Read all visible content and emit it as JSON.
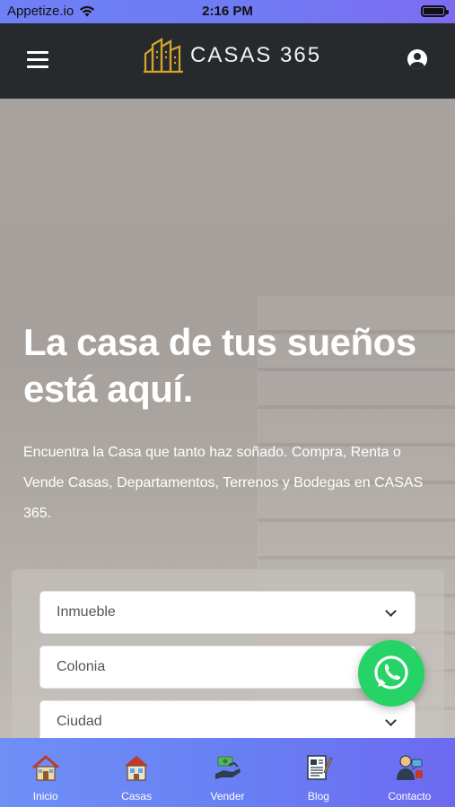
{
  "status_bar": {
    "carrier": "Appetize.io",
    "time": "2:16 PM"
  },
  "header": {
    "brand": "CASAS  365"
  },
  "hero": {
    "title_line1": "La casa de tus sueños",
    "title_line2": "está aquí.",
    "description": "Encuentra la Casa que tanto haz soñado. Compra, Renta o Vende Casas, Departamentos, Terrenos y Bodegas en CASAS 365."
  },
  "search": {
    "fields": [
      {
        "label": "Inmueble"
      },
      {
        "label": "Colonia"
      },
      {
        "label": "Ciudad"
      }
    ]
  },
  "bottom_nav": {
    "items": [
      {
        "label": "Inicio",
        "icon": "home-icon"
      },
      {
        "label": "Casas",
        "icon": "house-icon"
      },
      {
        "label": "Vender",
        "icon": "money-hand-icon"
      },
      {
        "label": "Blog",
        "icon": "blog-icon"
      },
      {
        "label": "Contacto",
        "icon": "contact-icon"
      }
    ]
  },
  "colors": {
    "header_bg": "#262a2c",
    "nav_gradient_start": "#6f8ff6",
    "nav_gradient_end": "#6d6af1",
    "whatsapp": "#25d366",
    "logo_gold": "#d8a52a"
  }
}
